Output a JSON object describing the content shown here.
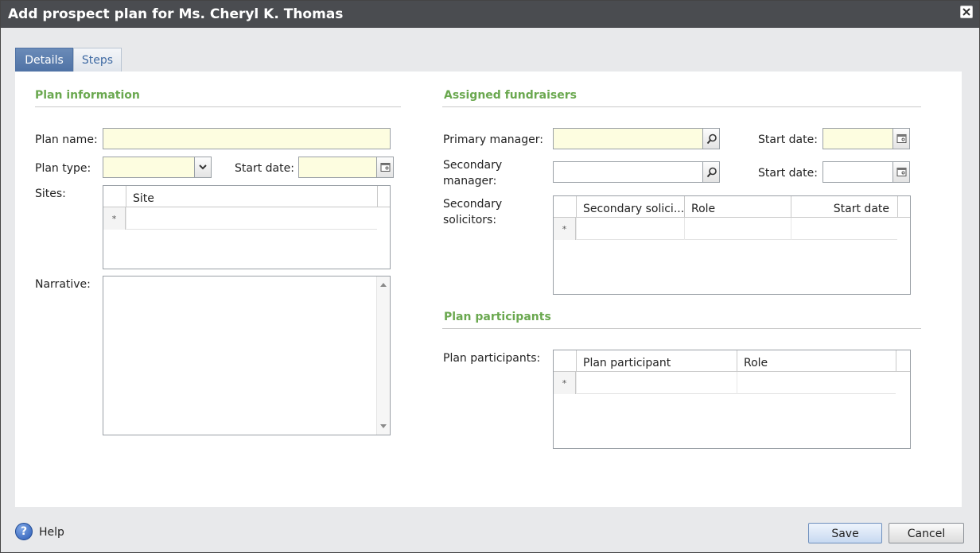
{
  "window": {
    "title": "Add prospect plan for Ms. Cheryl K. Thomas"
  },
  "tabs": [
    {
      "label": "Details",
      "active": true
    },
    {
      "label": "Steps",
      "active": false
    }
  ],
  "plan_info": {
    "section_title": "Plan information",
    "plan_name_label": "Plan name:",
    "plan_name_value": "",
    "plan_type_label": "Plan type:",
    "plan_type_value": "",
    "start_date_label": "Start date:",
    "start_date_value": "",
    "sites_label": "Sites:",
    "sites_grid": {
      "columns": [
        "Site"
      ],
      "new_row_marker": "*"
    },
    "narrative_label": "Narrative:",
    "narrative_value": ""
  },
  "fundraisers": {
    "section_title": "Assigned fundraisers",
    "primary_manager_label": "Primary manager:",
    "primary_start_label": "Start date:",
    "secondary_manager_label": "Secondary manager:",
    "secondary_start_label": "Start date:",
    "secondary_solicitors_label": "Secondary solicitors:",
    "solicitors_grid": {
      "columns": [
        "Secondary solici...",
        "Role",
        "Start date"
      ],
      "new_row_marker": "*"
    }
  },
  "participants": {
    "section_title": "Plan participants",
    "label": "Plan participants:",
    "grid": {
      "columns": [
        "Plan participant",
        "Role"
      ],
      "new_row_marker": "*"
    }
  },
  "footer": {
    "help_label": "Help",
    "help_glyph": "?",
    "save_label": "Save",
    "cancel_label": "Cancel"
  },
  "icons": {
    "search": "search-icon",
    "calendar": "calendar-icon",
    "dropdown": "chevron-down-icon",
    "close": "close-icon",
    "help": "help-icon"
  },
  "colors": {
    "section_title": "#6aa84f",
    "required_field": "#fdfde0",
    "titlebar": "#4a4c50",
    "active_tab": "#4f72a5"
  }
}
